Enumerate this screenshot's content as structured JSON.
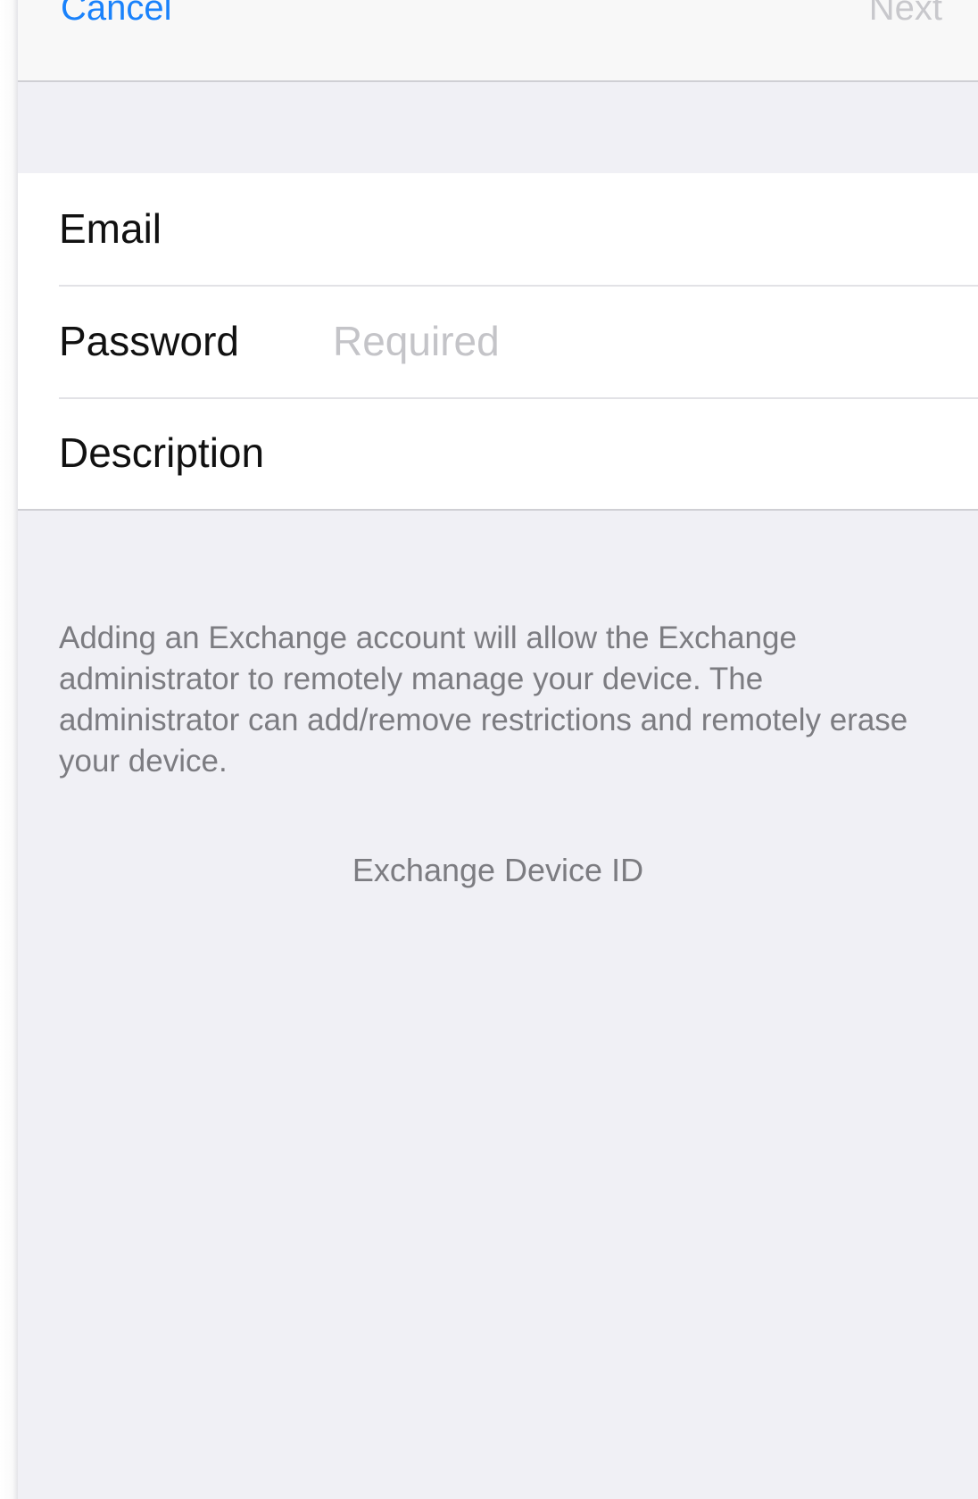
{
  "navbar": {
    "cancel_label": "Cancel",
    "next_label": "Next"
  },
  "form": {
    "email": {
      "label": "Email",
      "value": "",
      "placeholder": ""
    },
    "password": {
      "label": "Password",
      "value": "",
      "placeholder": "Required"
    },
    "description": {
      "label": "Description",
      "value": "",
      "placeholder": ""
    }
  },
  "info": {
    "text": "Adding an Exchange account will allow the Exchange administrator to remotely manage your device. The administrator can add/remove restrictions and remotely erase your device."
  },
  "device_id": {
    "label": "Exchange Device ID"
  },
  "colors": {
    "accent": "#1a82fb",
    "disabled": "#c8c8cc",
    "background": "#f0f0f5",
    "secondary_text": "#7c7c81"
  }
}
